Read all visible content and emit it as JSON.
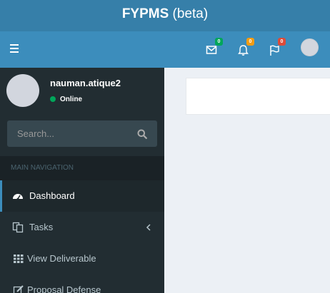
{
  "header": {
    "brand": "FYPMS",
    "suffix": "(beta)",
    "badges": {
      "messages": "0",
      "notifications": "0",
      "flags": "0"
    },
    "colors": {
      "messages_badge": "#00a65a",
      "notifications_badge": "#f39c12",
      "flags_badge": "#dd4b39",
      "navbar": "#3c8dbc",
      "logo": "#367fa9"
    }
  },
  "sidebar": {
    "user": {
      "name": "nauman.atique2",
      "status": "Online"
    },
    "search": {
      "placeholder": "Search..."
    },
    "section_header": "MAIN NAVIGATION",
    "items": [
      {
        "label": "Dashboard",
        "icon": "dashboard-icon",
        "active": true
      },
      {
        "label": "Tasks",
        "icon": "copy-icon",
        "has_submenu": true
      },
      {
        "label": "View Deliverable",
        "icon": "grid-icon"
      },
      {
        "label": "Proposal Defense",
        "icon": "edit-icon"
      }
    ]
  }
}
